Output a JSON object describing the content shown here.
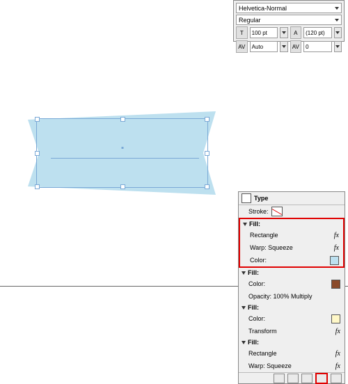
{
  "charPanel": {
    "font": "Helvetica-Normal",
    "style": "Regular",
    "size": "100 pt",
    "leading": "(120 pt)",
    "kerning": "Auto",
    "tracking": "0"
  },
  "typePanel": {
    "title": "Type",
    "strokeLabel": "Stroke:",
    "fillLabel": "Fill:",
    "rectangle": "Rectangle",
    "warp": "Warp: Squeeze",
    "colorLabel": "Color:",
    "opacity": "Opacity: 100% Multiply",
    "transform": "Transform",
    "fx": "fx",
    "colors": {
      "light": "#bde0ef",
      "brown": "#8a4a2a",
      "cream": "#fff8c8"
    }
  }
}
